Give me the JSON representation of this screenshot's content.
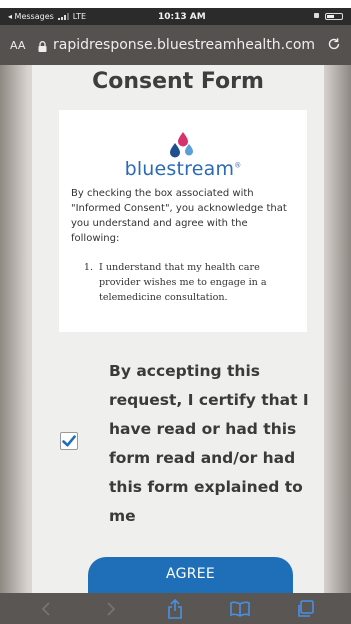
{
  "status_bar": {
    "back_app": "◂ Messages",
    "network": "LTE",
    "time": "10:13 AM"
  },
  "url_bar": {
    "text_size_label": "AA",
    "url": "rapidresponse.bluestreamhealth.com"
  },
  "form": {
    "title": "Consent Form",
    "logo_text": "bluestream",
    "logo_mark": "®",
    "intro": "By checking the box associated with \"Informed Consent\", you acknowledge that you understand and agree with the following:",
    "item_number": "1.",
    "item_text": "I understand that my health care provider wishes me to engage in a telemedicine consultation.",
    "certification": "By accepting this request, I certify that I have read or had this form read and/or had this form explained to me",
    "checkbox_checked": true,
    "agree_label": "AGREE"
  },
  "colors": {
    "brand_blue": "#2a6bb5",
    "button_blue": "#1f6fb8",
    "drop_pink": "#d6336c",
    "drop_navy": "#1f4f8f",
    "drop_light": "#5aa0d8"
  }
}
